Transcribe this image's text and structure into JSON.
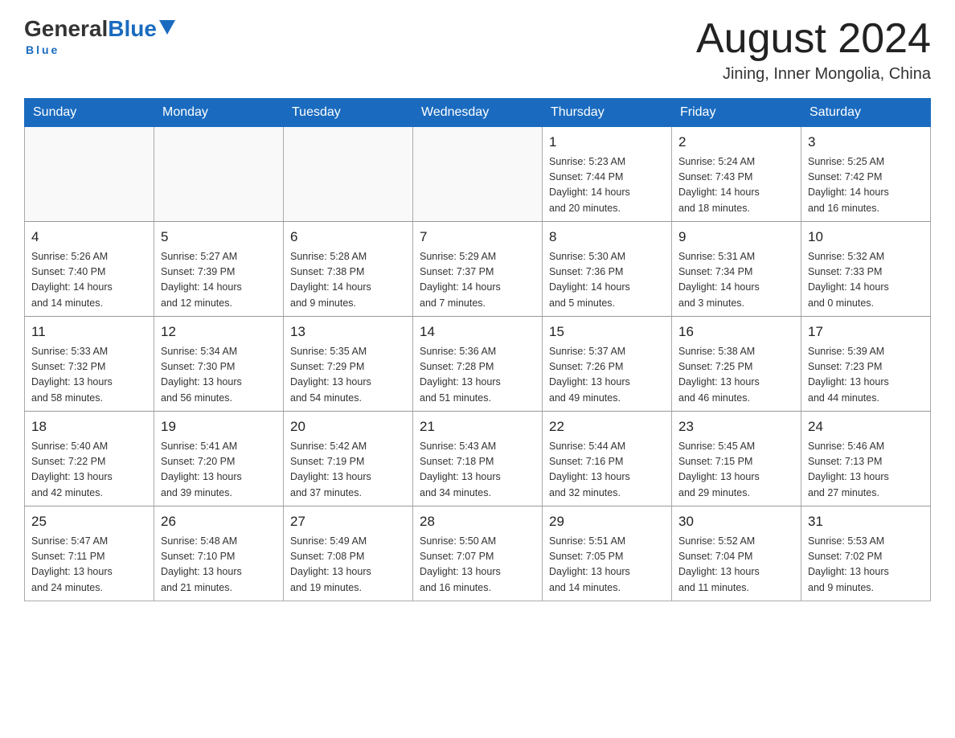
{
  "header": {
    "logo_general": "General",
    "logo_blue": "Blue",
    "logo_underline": "Blue",
    "month_title": "August 2024",
    "location": "Jining, Inner Mongolia, China"
  },
  "days_of_week": [
    "Sunday",
    "Monday",
    "Tuesday",
    "Wednesday",
    "Thursday",
    "Friday",
    "Saturday"
  ],
  "weeks": [
    [
      {
        "day": "",
        "info": ""
      },
      {
        "day": "",
        "info": ""
      },
      {
        "day": "",
        "info": ""
      },
      {
        "day": "",
        "info": ""
      },
      {
        "day": "1",
        "info": "Sunrise: 5:23 AM\nSunset: 7:44 PM\nDaylight: 14 hours\nand 20 minutes."
      },
      {
        "day": "2",
        "info": "Sunrise: 5:24 AM\nSunset: 7:43 PM\nDaylight: 14 hours\nand 18 minutes."
      },
      {
        "day": "3",
        "info": "Sunrise: 5:25 AM\nSunset: 7:42 PM\nDaylight: 14 hours\nand 16 minutes."
      }
    ],
    [
      {
        "day": "4",
        "info": "Sunrise: 5:26 AM\nSunset: 7:40 PM\nDaylight: 14 hours\nand 14 minutes."
      },
      {
        "day": "5",
        "info": "Sunrise: 5:27 AM\nSunset: 7:39 PM\nDaylight: 14 hours\nand 12 minutes."
      },
      {
        "day": "6",
        "info": "Sunrise: 5:28 AM\nSunset: 7:38 PM\nDaylight: 14 hours\nand 9 minutes."
      },
      {
        "day": "7",
        "info": "Sunrise: 5:29 AM\nSunset: 7:37 PM\nDaylight: 14 hours\nand 7 minutes."
      },
      {
        "day": "8",
        "info": "Sunrise: 5:30 AM\nSunset: 7:36 PM\nDaylight: 14 hours\nand 5 minutes."
      },
      {
        "day": "9",
        "info": "Sunrise: 5:31 AM\nSunset: 7:34 PM\nDaylight: 14 hours\nand 3 minutes."
      },
      {
        "day": "10",
        "info": "Sunrise: 5:32 AM\nSunset: 7:33 PM\nDaylight: 14 hours\nand 0 minutes."
      }
    ],
    [
      {
        "day": "11",
        "info": "Sunrise: 5:33 AM\nSunset: 7:32 PM\nDaylight: 13 hours\nand 58 minutes."
      },
      {
        "day": "12",
        "info": "Sunrise: 5:34 AM\nSunset: 7:30 PM\nDaylight: 13 hours\nand 56 minutes."
      },
      {
        "day": "13",
        "info": "Sunrise: 5:35 AM\nSunset: 7:29 PM\nDaylight: 13 hours\nand 54 minutes."
      },
      {
        "day": "14",
        "info": "Sunrise: 5:36 AM\nSunset: 7:28 PM\nDaylight: 13 hours\nand 51 minutes."
      },
      {
        "day": "15",
        "info": "Sunrise: 5:37 AM\nSunset: 7:26 PM\nDaylight: 13 hours\nand 49 minutes."
      },
      {
        "day": "16",
        "info": "Sunrise: 5:38 AM\nSunset: 7:25 PM\nDaylight: 13 hours\nand 46 minutes."
      },
      {
        "day": "17",
        "info": "Sunrise: 5:39 AM\nSunset: 7:23 PM\nDaylight: 13 hours\nand 44 minutes."
      }
    ],
    [
      {
        "day": "18",
        "info": "Sunrise: 5:40 AM\nSunset: 7:22 PM\nDaylight: 13 hours\nand 42 minutes."
      },
      {
        "day": "19",
        "info": "Sunrise: 5:41 AM\nSunset: 7:20 PM\nDaylight: 13 hours\nand 39 minutes."
      },
      {
        "day": "20",
        "info": "Sunrise: 5:42 AM\nSunset: 7:19 PM\nDaylight: 13 hours\nand 37 minutes."
      },
      {
        "day": "21",
        "info": "Sunrise: 5:43 AM\nSunset: 7:18 PM\nDaylight: 13 hours\nand 34 minutes."
      },
      {
        "day": "22",
        "info": "Sunrise: 5:44 AM\nSunset: 7:16 PM\nDaylight: 13 hours\nand 32 minutes."
      },
      {
        "day": "23",
        "info": "Sunrise: 5:45 AM\nSunset: 7:15 PM\nDaylight: 13 hours\nand 29 minutes."
      },
      {
        "day": "24",
        "info": "Sunrise: 5:46 AM\nSunset: 7:13 PM\nDaylight: 13 hours\nand 27 minutes."
      }
    ],
    [
      {
        "day": "25",
        "info": "Sunrise: 5:47 AM\nSunset: 7:11 PM\nDaylight: 13 hours\nand 24 minutes."
      },
      {
        "day": "26",
        "info": "Sunrise: 5:48 AM\nSunset: 7:10 PM\nDaylight: 13 hours\nand 21 minutes."
      },
      {
        "day": "27",
        "info": "Sunrise: 5:49 AM\nSunset: 7:08 PM\nDaylight: 13 hours\nand 19 minutes."
      },
      {
        "day": "28",
        "info": "Sunrise: 5:50 AM\nSunset: 7:07 PM\nDaylight: 13 hours\nand 16 minutes."
      },
      {
        "day": "29",
        "info": "Sunrise: 5:51 AM\nSunset: 7:05 PM\nDaylight: 13 hours\nand 14 minutes."
      },
      {
        "day": "30",
        "info": "Sunrise: 5:52 AM\nSunset: 7:04 PM\nDaylight: 13 hours\nand 11 minutes."
      },
      {
        "day": "31",
        "info": "Sunrise: 5:53 AM\nSunset: 7:02 PM\nDaylight: 13 hours\nand 9 minutes."
      }
    ]
  ]
}
